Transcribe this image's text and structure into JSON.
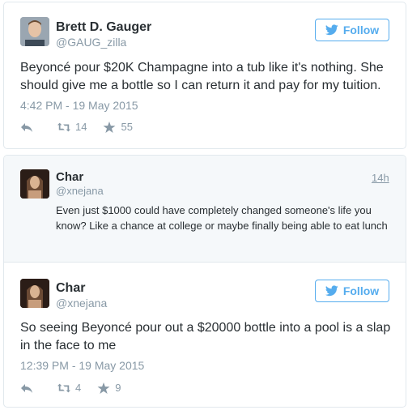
{
  "tweets": [
    {
      "name": "Brett D. Gauger",
      "handle": "@GAUG_zilla",
      "follow_label": "Follow",
      "text": "Beyoncé pour $20K Champagne into a tub like it's nothing. She should give me a bottle so I can return it and pay for my tuition.",
      "time": "4:42 PM - 19 May 2015",
      "retweets": "14",
      "favorites": "55"
    }
  ],
  "reply": {
    "name": "Char",
    "handle": "@xnejana",
    "time": "14h",
    "text": "Even just $1000 could have completely changed someone's life you know? Like a chance at college or maybe finally being able to eat lunch"
  },
  "second_tweet": {
    "name": "Char",
    "handle": "@xnejana",
    "follow_label": "Follow",
    "text": "So seeing Beyoncé pour out a $20000 bottle into a pool is a slap in the face to me",
    "time": "12:39 PM - 19 May 2015",
    "retweets": "4",
    "favorites": "9"
  },
  "colors": {
    "accent": "#55acee",
    "muted": "#8899a6",
    "text": "#292f33",
    "border": "#e1e8ed"
  },
  "icons": [
    "twitter-bird-icon",
    "reply-icon",
    "retweet-icon",
    "favorite-star-icon"
  ]
}
